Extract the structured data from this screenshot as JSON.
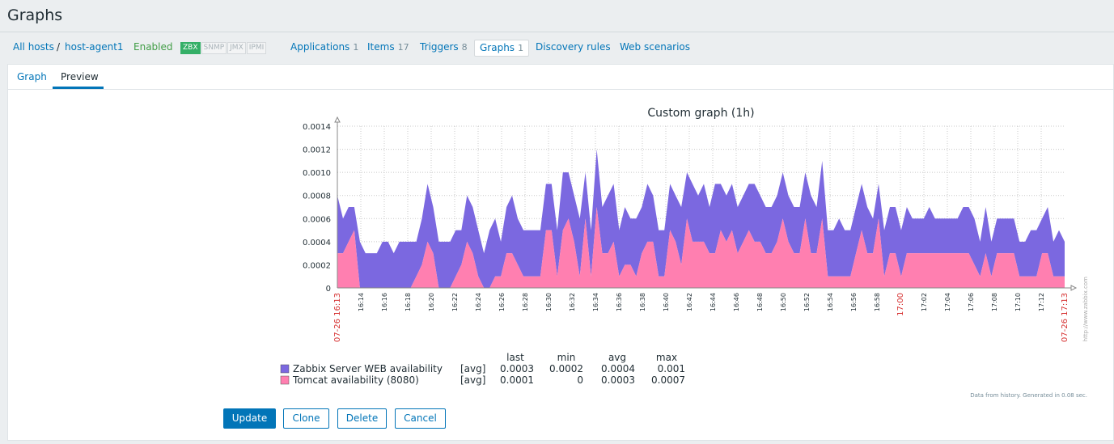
{
  "page": {
    "title": "Graphs"
  },
  "nav": {
    "all_hosts": "All hosts",
    "separator": "/",
    "host": "host-agent1",
    "status": "Enabled",
    "availability": [
      "ZBX",
      "SNMP",
      "JMX",
      "IPMI"
    ],
    "applications": {
      "label": "Applications",
      "count": "1"
    },
    "items": {
      "label": "Items",
      "count": "17"
    },
    "triggers": {
      "label": "Triggers",
      "count": "8"
    },
    "graphs": {
      "label": "Graphs",
      "count": "1"
    },
    "discovery": "Discovery rules",
    "web": "Web scenarios"
  },
  "tabs": [
    "Graph",
    "Preview"
  ],
  "buttons": {
    "update": "Update",
    "clone": "Clone",
    "delete": "Delete",
    "cancel": "Cancel"
  },
  "colors": {
    "accent": "#0275b8",
    "series_web": "#7b68e0",
    "series_tomcat": "#ff7fb0",
    "time_red": "#d63131"
  },
  "chart_data": {
    "type": "area",
    "title": "Custom graph (1h)",
    "stacked": true,
    "ylim": [
      0,
      0.0014
    ],
    "y_ticks": [
      "0.0014",
      "0.0012",
      "0.0010",
      "0.0008",
      "0.0006",
      "0.0004",
      "0.0002",
      "0"
    ],
    "x_ticks": [
      "16:14",
      "16:16",
      "16:18",
      "16:20",
      "16:22",
      "16:24",
      "16:26",
      "16:28",
      "16:30",
      "16:32",
      "16:34",
      "16:36",
      "16:38",
      "16:40",
      "16:42",
      "16:44",
      "16:46",
      "16:48",
      "16:50",
      "16:52",
      "16:54",
      "16:56",
      "16:58",
      "17:00",
      "17:02",
      "17:04",
      "17:06",
      "17:08",
      "17:10",
      "17:12"
    ],
    "x_start_label": "07-26 16:13",
    "x_end_label": "07-26 17:13",
    "x_highlight": "17:00",
    "watermark": "http://www.zabbix.com",
    "footer_note": "Data from history. Generated in 0.08 sec.",
    "legend_header": [
      "last",
      "min",
      "avg",
      "max"
    ],
    "series": [
      {
        "name": "Zabbix Server WEB availability",
        "func": "[avg]",
        "last": "0.0003",
        "min": "0.0002",
        "avg": "0.0004",
        "max": "0.001",
        "values": [
          0.0005,
          0.0003,
          0.0003,
          0.0002,
          0.0004,
          0.0003,
          0.0003,
          0.0003,
          0.0004,
          0.0004,
          0.0003,
          0.0004,
          0.0004,
          0.0004,
          0.0003,
          0.0004,
          0.0005,
          0.0004,
          0.0004,
          0.0004,
          0.0004,
          0.0004,
          0.0003,
          0.0004,
          0.0004,
          0.0004,
          0.0003,
          0.0005,
          0.0005,
          0.0003,
          0.0004,
          0.0005,
          0.0004,
          0.0004,
          0.0004,
          0.0004,
          0.0004,
          0.0004,
          0.0004,
          0.0004,
          0.0005,
          0.0004,
          0.0004,
          0.0005,
          0.0004,
          0.0004,
          0.0005,
          0.0004,
          0.0005,
          0.0005,
          0.0004,
          0.0005,
          0.0004,
          0.0005,
          0.0004,
          0.0005,
          0.0004,
          0.0004,
          0.0004,
          0.0004,
          0.0004,
          0.0005,
          0.0004,
          0.0005,
          0.0004,
          0.0005,
          0.0004,
          0.0006,
          0.0004,
          0.0004,
          0.0004,
          0.0004,
          0.0004,
          0.0004,
          0.0005,
          0.0004,
          0.0004,
          0.0004,
          0.0004,
          0.0004,
          0.0004,
          0.0004,
          0.0004,
          0.0004,
          0.0005,
          0.0004,
          0.0005,
          0.0004,
          0.0004,
          0.0005,
          0.0004,
          0.0004,
          0.0004,
          0.0004,
          0.0004,
          0.0003,
          0.0003,
          0.0004,
          0.0004,
          0.0004,
          0.0004,
          0.0004,
          0.0003,
          0.0003,
          0.0003,
          0.0004,
          0.0003,
          0.0003,
          0.0003,
          0.0003,
          0.0003,
          0.0004,
          0.0004,
          0.0004,
          0.0003,
          0.0004,
          0.0003,
          0.0003,
          0.0003,
          0.0003,
          0.0003,
          0.0003,
          0.0003,
          0.0004,
          0.0004,
          0.0003,
          0.0004,
          0.0003,
          0.0004,
          0.0003
        ]
      },
      {
        "name": "Tomcat availability (8080)",
        "func": "[avg]",
        "last": "0.0001",
        "min": "0",
        "avg": "0.0003",
        "max": "0.0007",
        "values": [
          0.0003,
          0.0003,
          0.0004,
          0.0005,
          0.0,
          0.0,
          0.0,
          0.0,
          0.0,
          0.0,
          0.0,
          0.0,
          0.0,
          0.0,
          0.0001,
          0.0002,
          0.0004,
          0.0003,
          0.0,
          0.0,
          0.0,
          0.0001,
          0.0002,
          0.0004,
          0.0003,
          0.0001,
          0.0,
          0.0,
          0.0001,
          0.0001,
          0.0003,
          0.0003,
          0.0002,
          0.0001,
          0.0001,
          0.0001,
          0.0001,
          0.0005,
          0.0005,
          0.0001,
          0.0005,
          0.0006,
          0.0004,
          0.0001,
          0.0006,
          0.0001,
          0.0007,
          0.0003,
          0.0003,
          0.0004,
          0.0001,
          0.0002,
          0.0002,
          0.0001,
          0.0003,
          0.0004,
          0.0004,
          0.0001,
          0.0001,
          0.0005,
          0.0004,
          0.0002,
          0.0006,
          0.0004,
          0.0004,
          0.0004,
          0.0003,
          0.0003,
          0.0005,
          0.0004,
          0.0005,
          0.0003,
          0.0004,
          0.0005,
          0.0004,
          0.0004,
          0.0003,
          0.0003,
          0.0004,
          0.0006,
          0.0004,
          0.0003,
          0.0003,
          0.0006,
          0.0003,
          0.0003,
          0.0006,
          0.0001,
          0.0001,
          0.0001,
          0.0001,
          0.0001,
          0.0003,
          0.0005,
          0.0003,
          0.0003,
          0.0006,
          0.0001,
          0.0003,
          0.0003,
          0.0001,
          0.0003,
          0.0003,
          0.0003,
          0.0003,
          0.0003,
          0.0003,
          0.0003,
          0.0003,
          0.0003,
          0.0003,
          0.0003,
          0.0003,
          0.0002,
          0.0001,
          0.0003,
          0.0001,
          0.0003,
          0.0003,
          0.0003,
          0.0003,
          0.0001,
          0.0001,
          0.0001,
          0.0001,
          0.0003,
          0.0003,
          0.0001,
          0.0001,
          0.0001
        ]
      }
    ]
  }
}
